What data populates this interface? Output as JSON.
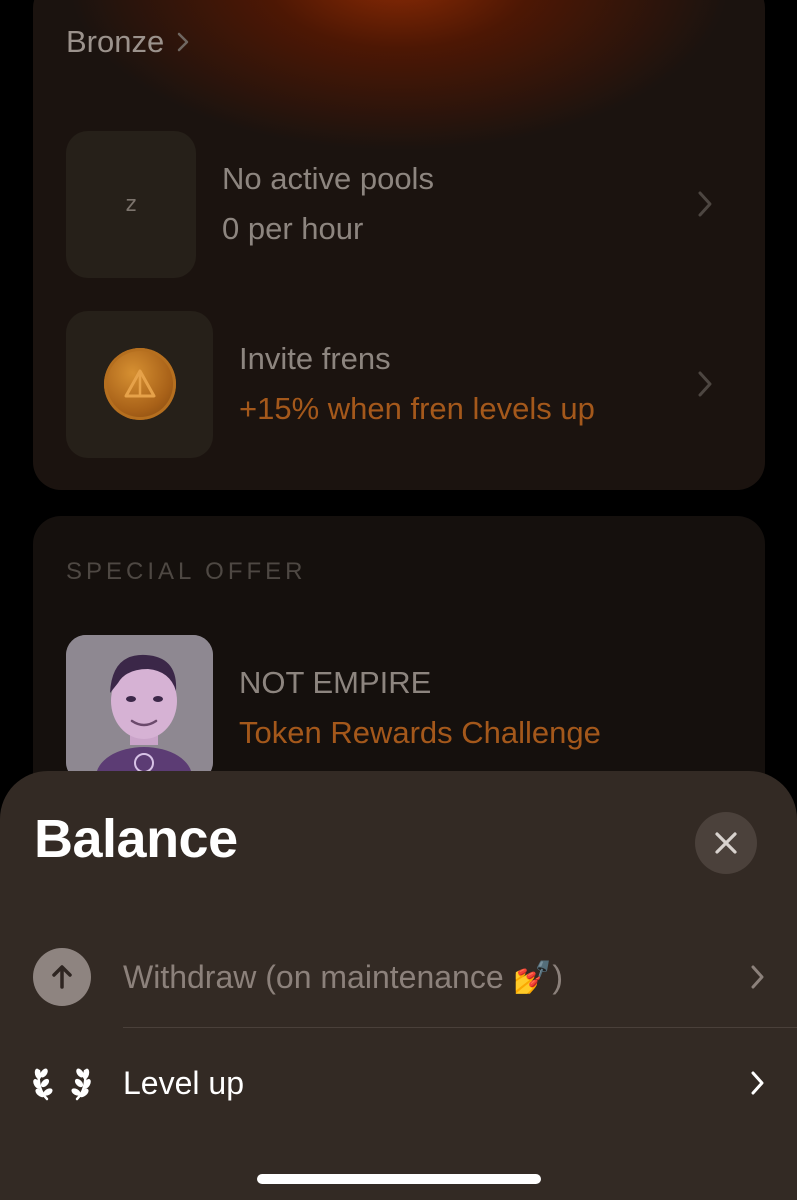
{
  "background": {
    "tier": {
      "label": "Bronze"
    },
    "pools": {
      "title": "No active pools",
      "subtitle": "0 per hour",
      "icon": "sleep-icon"
    },
    "invite": {
      "title": "Invite frens",
      "subtitle": "+15% when fren levels up",
      "icon": "coin-icon"
    },
    "special_offer": {
      "section_label": "SPECIAL OFFER",
      "title": "NOT EMPIRE",
      "subtitle": "Token Rewards Challenge",
      "image": "avatar-image"
    }
  },
  "sheet": {
    "title": "Balance",
    "close_icon": "close-icon",
    "items": [
      {
        "label": "Withdraw (on maintenance 💅)",
        "icon": "arrow-up-circle-icon",
        "enabled": false
      },
      {
        "label": "Level up",
        "icon": "laurel-icon",
        "enabled": true
      }
    ]
  },
  "colors": {
    "accent": "#a4581b",
    "sheet_bg": "#332a24",
    "card_bg": "#1b130f"
  }
}
